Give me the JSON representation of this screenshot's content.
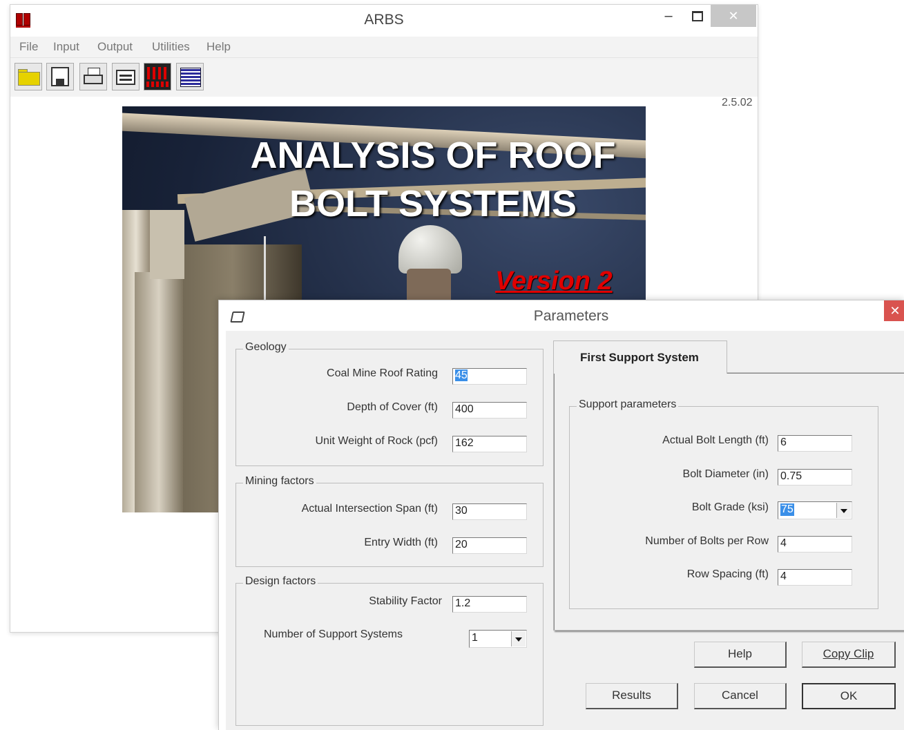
{
  "main_window": {
    "title": "ARBS",
    "version": "2.5.02",
    "menu": [
      "File",
      "Input",
      "Output",
      "Utilities",
      "Help"
    ],
    "toolbar": [
      "open-icon",
      "save-icon",
      "print-icon",
      "edit-icon",
      "bolt-pattern-icon",
      "table-icon"
    ],
    "splash": {
      "title_line1": "ANALYSIS OF ROOF",
      "title_line2": "BOLT SYSTEMS",
      "version_label": "Version 2"
    }
  },
  "dialog": {
    "title": "Parameters",
    "geology": {
      "label": "Geology",
      "cmrr_label": "Coal Mine Roof Rating",
      "cmrr_value": "45",
      "depth_label": "Depth of Cover (ft)",
      "depth_value": "400",
      "unit_weight_label": "Unit Weight of Rock (pcf)",
      "unit_weight_value": "162"
    },
    "mining": {
      "label": "Mining factors",
      "span_label": "Actual Intersection Span (ft)",
      "span_value": "30",
      "entry_label": "Entry Width (ft)",
      "entry_value": "20"
    },
    "design": {
      "label": "Design factors",
      "stability_label": "Stability Factor",
      "stability_value": "1.2",
      "systems_label": "Number of Support Systems",
      "systems_value": "1"
    },
    "tab": {
      "label": "First Support System",
      "group_label": "Support parameters",
      "bolt_length_label": "Actual Bolt Length (ft)",
      "bolt_length_value": "6",
      "bolt_diameter_label": "Bolt Diameter (in)",
      "bolt_diameter_value": "0.75",
      "bolt_grade_label": "Bolt Grade (ksi)",
      "bolt_grade_value": "75",
      "bolts_per_row_label": "Number of Bolts per Row",
      "bolts_per_row_value": "4",
      "row_spacing_label": "Row Spacing (ft)",
      "row_spacing_value": "4"
    },
    "buttons": {
      "help": "Help",
      "copy_clip": "Copy Clip",
      "results": "Results",
      "cancel": "Cancel",
      "ok": "OK"
    }
  }
}
